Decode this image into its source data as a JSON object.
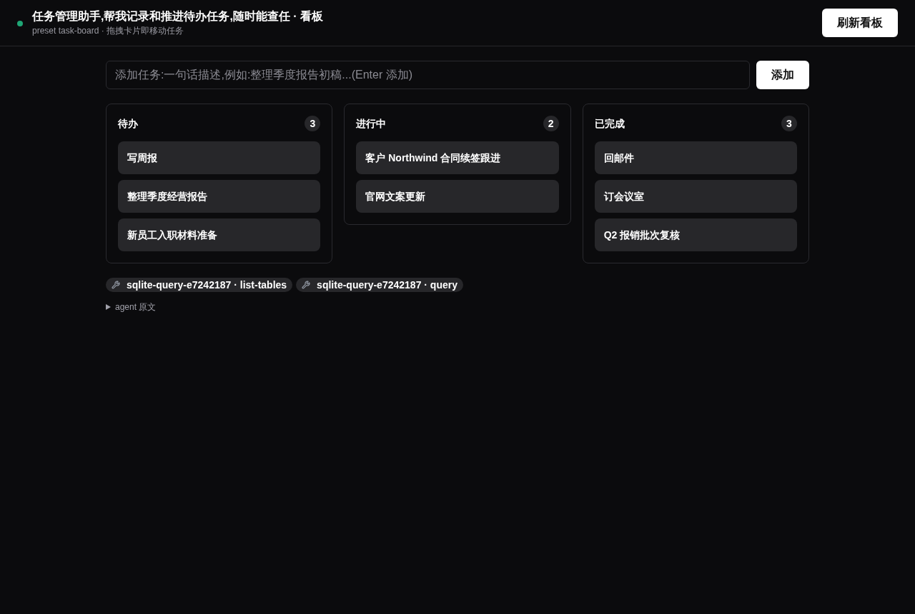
{
  "header": {
    "title": "任务管理助手,帮我记录和推进待办任务,随时能查任 · 看板",
    "subtitle": "preset task-board · 拖拽卡片即移动任务",
    "refresh_button": "刷新看板"
  },
  "add_task": {
    "placeholder": "添加任务:一句话描述,例如:整理季度报告初稿...(Enter 添加)",
    "button": "添加"
  },
  "columns": [
    {
      "title": "待办",
      "count": "3",
      "cards": [
        "写周报",
        "整理季度经营报告",
        "新员工入职材料准备"
      ]
    },
    {
      "title": "进行中",
      "count": "2",
      "cards": [
        "客户 Northwind 合同续签跟进",
        "官网文案更新"
      ]
    },
    {
      "title": "已完成",
      "count": "3",
      "cards": [
        "回邮件",
        "订会议室",
        "Q2 报销批次复核"
      ]
    }
  ],
  "tool_calls": [
    "sqlite-query-e7242187 · list-tables",
    "sqlite-query-e7242187 · query"
  ],
  "agent_raw": {
    "label": "agent 原文",
    "expanded": false
  }
}
